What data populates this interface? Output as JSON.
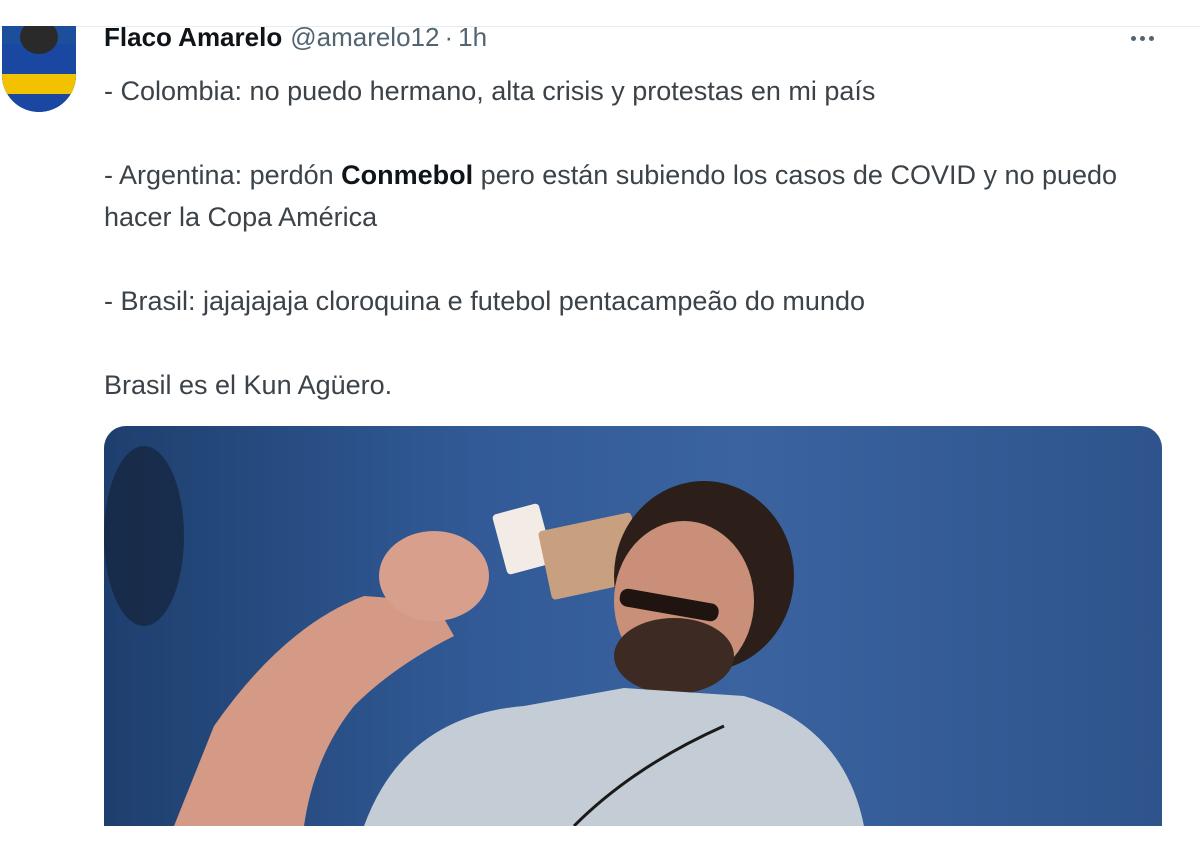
{
  "tweet": {
    "display_name": "Flaco Amarelo",
    "handle": "@amarelo12",
    "separator": "·",
    "time": "1h",
    "paragraphs": [
      [
        {
          "text": "- Colombia: no puedo hermano, alta crisis y protestas en mi país"
        }
      ],
      [
        {
          "text": "- Argentina: perdón "
        },
        {
          "text": "Conmebol",
          "bold": true
        },
        {
          "text": " pero están subiendo los casos de COVID y no puedo hacer la Copa América"
        }
      ],
      [
        {
          "text": "- Brasil: jajajajaja cloroquina e futebol pentacampeão do mundo"
        }
      ],
      [
        {
          "text": "Brasil es el Kun Agüero."
        }
      ]
    ]
  },
  "icons": {
    "more": "more-horizontal-icon"
  },
  "colors": {
    "name": "#0f1419",
    "secondary": "#536471",
    "body_text": "#3b4248",
    "media_bg": "#315a96"
  }
}
